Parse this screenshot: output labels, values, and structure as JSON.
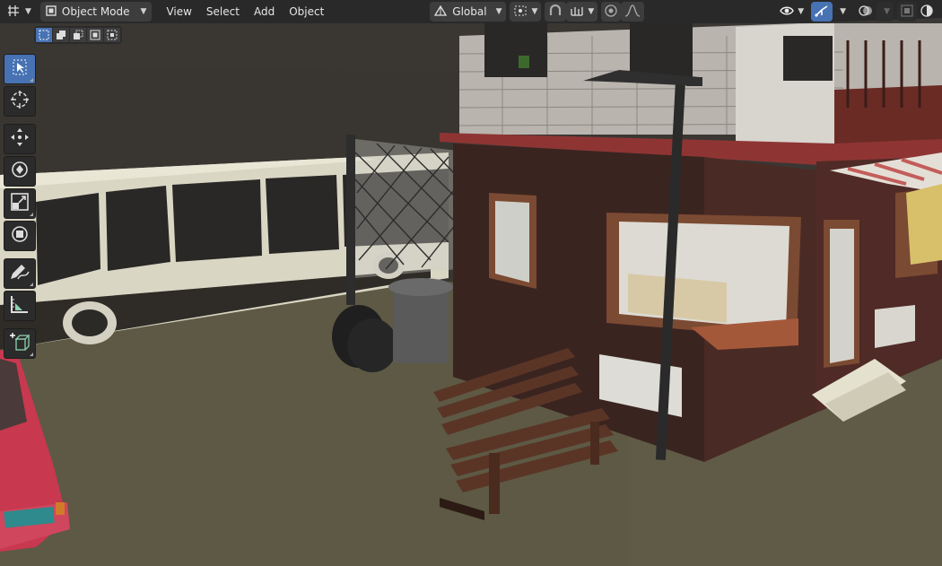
{
  "header": {
    "editor_type_icon": "globe-axes-icon",
    "mode": {
      "icon": "object-mode-icon",
      "label": "Object Mode"
    },
    "menus": [
      "View",
      "Select",
      "Add",
      "Object"
    ],
    "transform_orientation": {
      "icon": "orientation-icon",
      "label": "Global"
    },
    "pivot_icon": "pivot-icon",
    "snap_icon": "magnet-icon",
    "snap_target_icon": "snap-target-icon",
    "proportional_icon": "proportional-edit-icon",
    "falloff_icon": "falloff-curve-icon",
    "visibility_icon": "eye-icon",
    "gizmo_icon": "gizmo-icon",
    "overlay_icon": "overlay-icon",
    "xray_icon": "xray-icon",
    "shading_solid_icon": "solid-shading-icon"
  },
  "select_modes": [
    {
      "name": "select-new",
      "active": true
    },
    {
      "name": "select-extend",
      "active": false
    },
    {
      "name": "select-subtract",
      "active": false
    },
    {
      "name": "select-invert",
      "active": false
    },
    {
      "name": "select-intersect",
      "active": false
    }
  ],
  "tools": [
    {
      "name": "select-box-tool",
      "icon": "cursor-arrow-icon",
      "active": true
    },
    {
      "name": "cursor-tool",
      "icon": "3d-cursor-icon",
      "active": false
    },
    {
      "name": "move-tool",
      "icon": "move-arrows-icon",
      "active": false
    },
    {
      "name": "rotate-tool",
      "icon": "rotate-icon",
      "active": false
    },
    {
      "name": "scale-tool",
      "icon": "scale-icon",
      "active": false
    },
    {
      "name": "transform-tool",
      "icon": "transform-icon",
      "active": false
    },
    {
      "name": "annotate-tool",
      "icon": "pencil-icon",
      "active": false
    },
    {
      "name": "measure-tool",
      "icon": "ruler-icon",
      "active": false
    },
    {
      "name": "add-cube-tool",
      "icon": "add-cube-icon",
      "active": false
    }
  ],
  "colors": {
    "accent": "#4772b3",
    "header_bg": "#282828",
    "ground": "#5f5b46",
    "sky": "#3a3733"
  }
}
